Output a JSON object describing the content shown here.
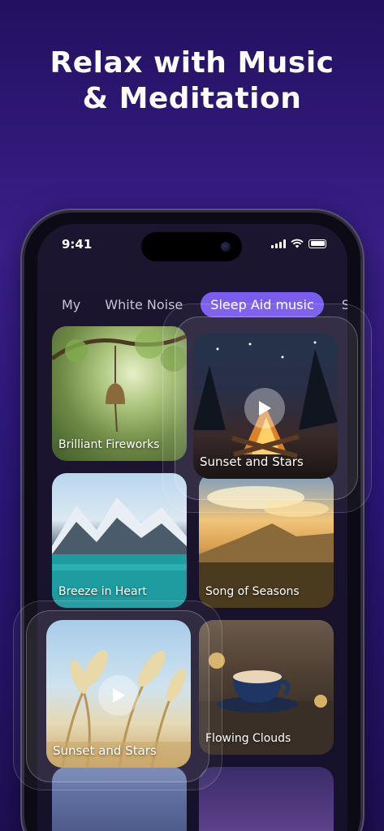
{
  "headline": {
    "line1": "Relax with Music",
    "line2": "& Meditation"
  },
  "status_bar": {
    "time": "9:41"
  },
  "tabs": [
    {
      "label": "My"
    },
    {
      "label": "White Noise"
    },
    {
      "label": "Sleep Aid music",
      "active": true
    },
    {
      "label": "Sc"
    }
  ],
  "cards": [
    {
      "title": "Brilliant Fireworks"
    },
    {
      "title": "Sunset and Stars",
      "playing": true
    },
    {
      "title": "Breeze in Heart"
    },
    {
      "title": "Song of Seasons"
    },
    {
      "title": "Sunset and Stars",
      "playing": true
    },
    {
      "title": "Flowing Clouds"
    }
  ],
  "colors": {
    "accent": "#7b5cf0",
    "background": "#2b177a"
  }
}
